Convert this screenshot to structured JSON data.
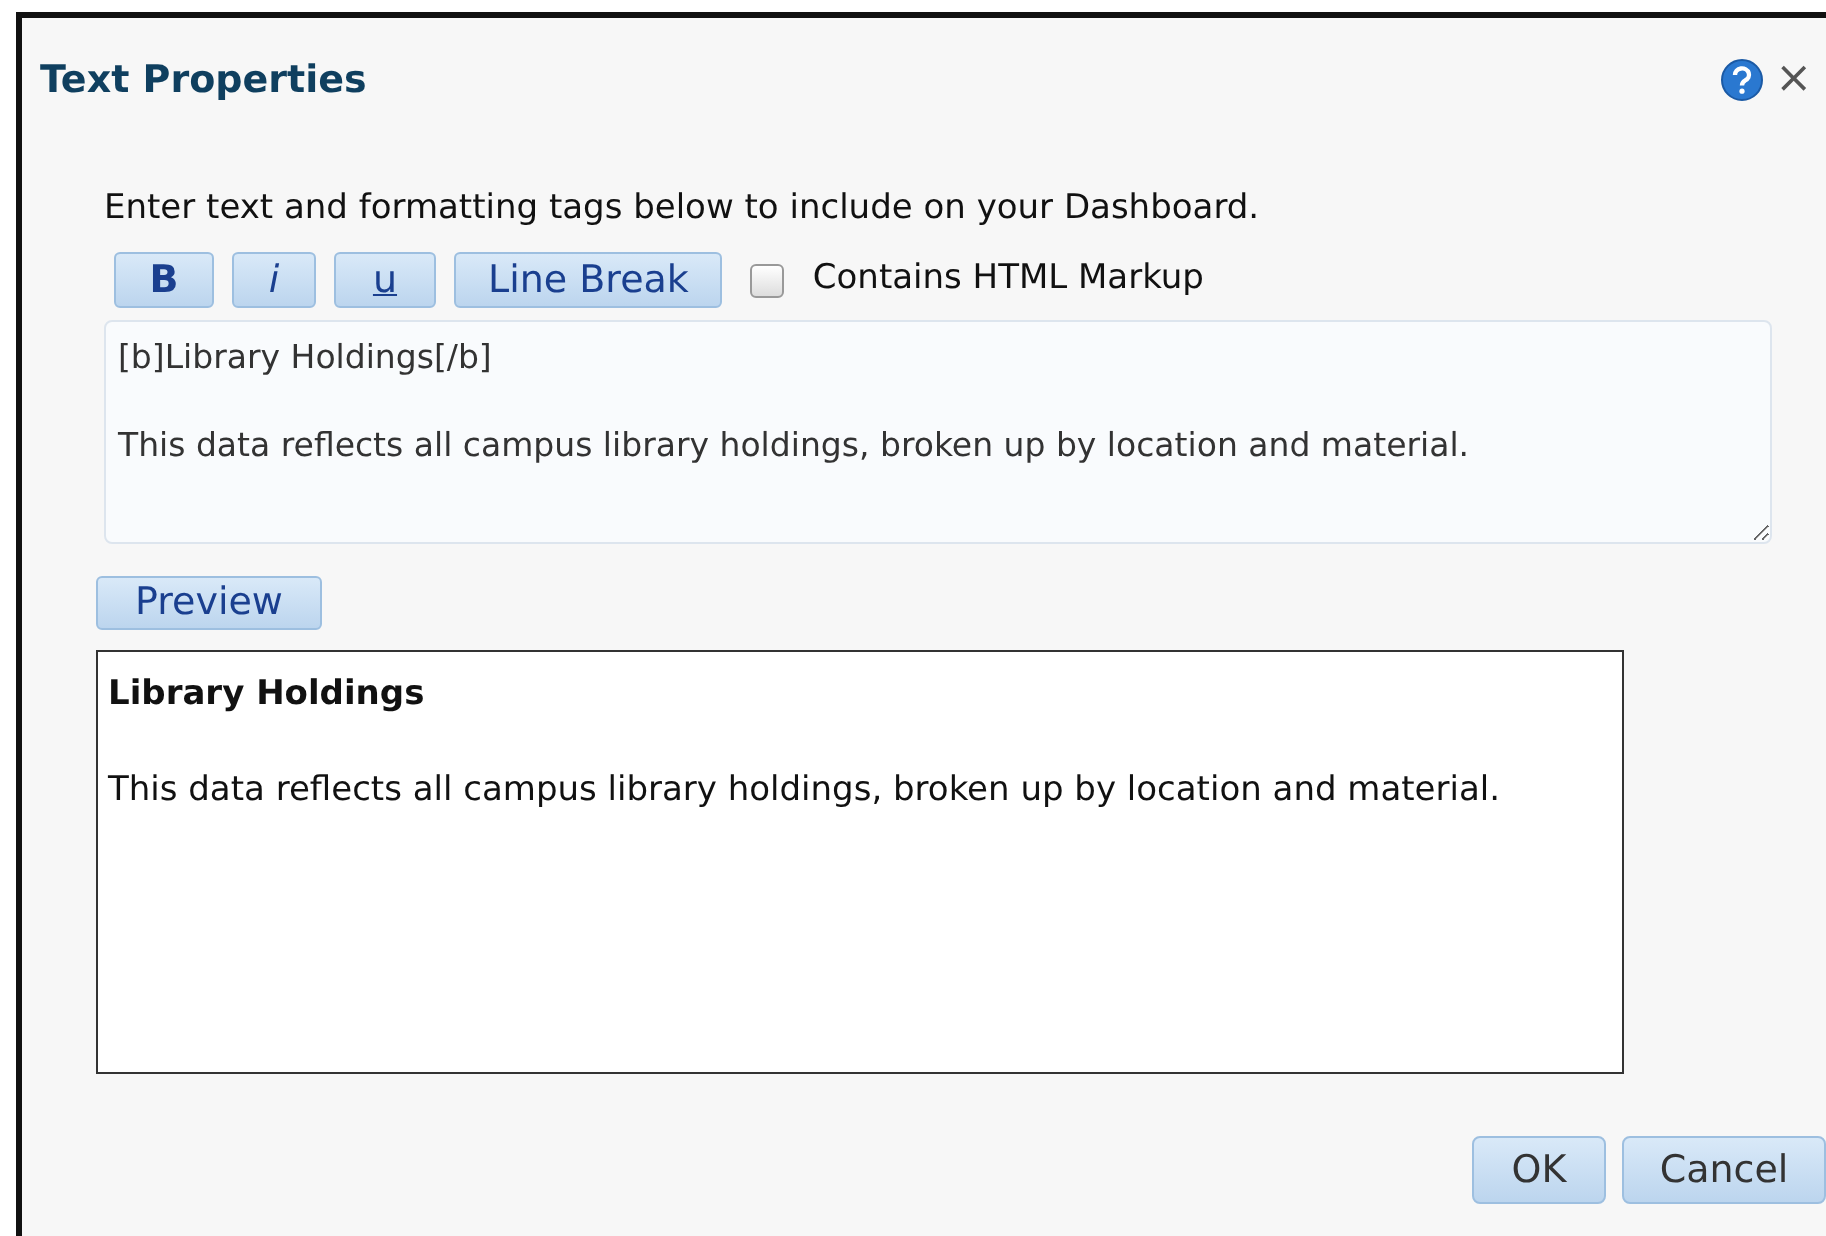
{
  "dialog": {
    "title": "Text Properties",
    "close": "×"
  },
  "instruction": "Enter text and formatting tags below to include on your Dashboard.",
  "format_buttons": [
    {
      "label": "B",
      "kind": "bold"
    },
    {
      "label": "i",
      "kind": "italic"
    },
    {
      "label": "u",
      "kind": "underline"
    },
    {
      "label": "Line Break",
      "kind": "plain"
    }
  ],
  "html_markup": {
    "label": "Contains HTML Markup",
    "checked": false
  },
  "text_field": {
    "value": "[b]Library Holdings[/b]\n\nThis data reflects all campus library holdings, broken up by location and material."
  },
  "preview_button": "Preview",
  "preview": {
    "heading": "Library Holdings",
    "body": "This data reflects all campus library holdings, broken up by location and material."
  },
  "buttons": [
    "OK",
    "Cancel"
  ]
}
